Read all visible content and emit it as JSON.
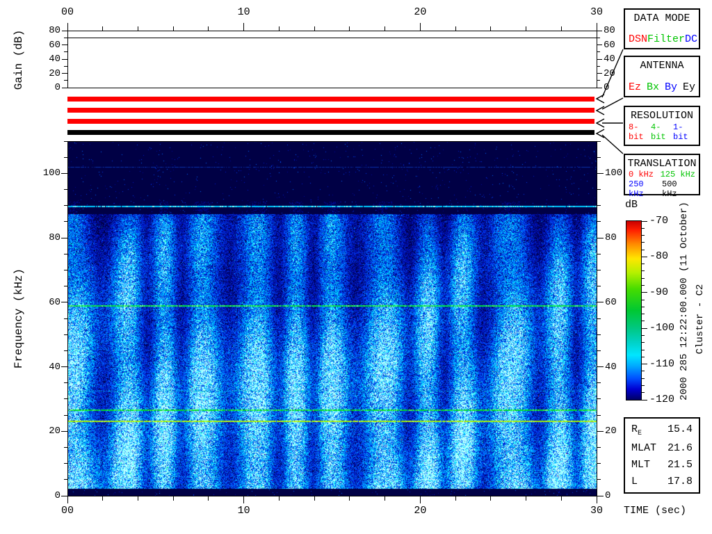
{
  "labels": {
    "gain_axis": "Gain (dB)",
    "freq_axis": "Frequency (kHz)",
    "time_axis": "TIME (sec)",
    "colorbar_title": "dB",
    "timestamp_rotated": "2000 285 12:22:00.000 (11 October)",
    "spacecraft_rotated": "Cluster - C2"
  },
  "colors": {
    "red": "#ff0000",
    "green": "#00c400",
    "blue": "#0000ff",
    "black": "#000000",
    "plot_background_navy": "#000045"
  },
  "status_bars": [
    {
      "name": "data-mode-bar",
      "color": "#ff0000"
    },
    {
      "name": "antenna-bar",
      "color": "#ff0000"
    },
    {
      "name": "resolution-bar",
      "color": "#ff0000"
    },
    {
      "name": "translation-bar",
      "color": "#000000"
    }
  ],
  "legend_boxes": [
    {
      "title": "DATA MODE",
      "rows": [
        [
          {
            "label": "DSN",
            "color": "#ff0000"
          },
          {
            "label": "Filter",
            "color": "#00c400"
          },
          {
            "label": "DC",
            "color": "#0000ff"
          }
        ]
      ]
    },
    {
      "title": "ANTENNA",
      "rows": [
        [
          {
            "label": "Ez",
            "color": "#ff0000"
          },
          {
            "label": "Bx",
            "color": "#00c400"
          },
          {
            "label": "By",
            "color": "#0000ff"
          },
          {
            "label": "Ey",
            "color": "#000000"
          }
        ]
      ]
    },
    {
      "title": "RESOLUTION",
      "rows": [
        [
          {
            "label": "8-bit",
            "color": "#ff0000"
          },
          {
            "label": "4-bit",
            "color": "#00c400"
          },
          {
            "label": "1-bit",
            "color": "#0000ff"
          }
        ]
      ]
    },
    {
      "title": "TRANSLATION",
      "rows": [
        [
          {
            "label": "0 kHz",
            "color": "#ff0000"
          },
          {
            "label": "125 kHz",
            "color": "#00c400"
          }
        ],
        [
          {
            "label": "250 kHz",
            "color": "#0000ff"
          },
          {
            "label": "500 kHz",
            "color": "#000000"
          }
        ]
      ]
    }
  ],
  "ephemeris": {
    "rows": [
      {
        "label": "R",
        "sub": "E",
        "value": "15.4"
      },
      {
        "label": "MLAT",
        "sub": "",
        "value": "21.6"
      },
      {
        "label": "MLT",
        "sub": "",
        "value": "21.5"
      },
      {
        "label": "L",
        "sub": "",
        "value": "17.8"
      }
    ]
  },
  "chart_data": [
    {
      "type": "line",
      "title": "Receiver gain vs time",
      "x_axis": {
        "range_sec": [
          0,
          30
        ],
        "label_values": [
          0,
          10,
          20,
          30
        ],
        "labels": [
          "00",
          "10",
          "20",
          "30"
        ],
        "minor_step_sec": 2
      },
      "y_axis": {
        "title": "Gain (dB)",
        "range_db": [
          0,
          80
        ],
        "label_values": [
          0,
          20,
          40,
          60,
          80
        ],
        "labels": [
          "0",
          "20",
          "40",
          "60",
          "80"
        ],
        "minor_step_db": 10
      },
      "series": [
        {
          "name": "gain",
          "shape": "constant",
          "value_db": 70
        }
      ]
    },
    {
      "type": "heatmap",
      "title": "Cluster WBD wideband spectrogram",
      "x_axis": {
        "title": "TIME (sec)",
        "range_sec": [
          0,
          30
        ],
        "label_values": [
          0,
          10,
          20,
          30
        ],
        "labels": [
          "00",
          "10",
          "20",
          "30"
        ],
        "minor_step_sec": 2
      },
      "y_axis": {
        "title": "Frequency (kHz)",
        "range_khz": [
          0,
          110
        ],
        "label_values": [
          0,
          20,
          40,
          60,
          80,
          100
        ],
        "labels": [
          "0",
          "20",
          "40",
          "60",
          "80",
          "100"
        ],
        "minor_step_khz": 5
      },
      "colorbar": {
        "title": "dB",
        "range_db": [
          -120,
          -70
        ],
        "label_values": [
          -70,
          -80,
          -90,
          -100,
          -110,
          -120
        ],
        "labels": [
          "-70",
          "-80",
          "-90",
          "-100",
          "-110",
          "-120"
        ],
        "minor_step_db": 2,
        "stops": [
          [
            0,
            "#c80000"
          ],
          [
            0.05,
            "#ff1e00"
          ],
          [
            0.13,
            "#ff8c00"
          ],
          [
            0.21,
            "#ffe600"
          ],
          [
            0.29,
            "#b4f000"
          ],
          [
            0.38,
            "#46dc00"
          ],
          [
            0.5,
            "#00c832"
          ],
          [
            0.6,
            "#00c882"
          ],
          [
            0.68,
            "#00d2c8"
          ],
          [
            0.75,
            "#00e6ff"
          ],
          [
            0.81,
            "#00aaff"
          ],
          [
            0.88,
            "#0050ff"
          ],
          [
            0.94,
            "#0000d2"
          ],
          [
            1,
            "#000064"
          ]
        ]
      },
      "description": "Broadband blue/cyan noise below ~88 kHz with quasi-periodic vertical banding (~2.5 s period); dark navy (no signal) above ~90 kHz",
      "spectral_lines": [
        {
          "freq_khz": 102,
          "color": "#0a2fa8",
          "bright": "",
          "width": 1,
          "density": 0.7
        },
        {
          "freq_khz": 90,
          "color": "#00c8ff",
          "bright": "#86ffff",
          "width": 2,
          "density": 0.97
        },
        {
          "freq_khz": 59,
          "color": "#00e046",
          "bright": "#7dff7d",
          "width": 2,
          "density": 0.97
        },
        {
          "freq_khz": 32.5,
          "color": "#0096d2",
          "bright": "",
          "width": 1,
          "density": 0.55
        },
        {
          "freq_khz": 26.8,
          "color": "#00dc28",
          "bright": "#64ff64",
          "width": 2,
          "density": 0.95
        },
        {
          "freq_khz": 23.2,
          "color": "#a0f000",
          "bright": "#d2ff46",
          "width": 2,
          "density": 0.97
        }
      ],
      "render": {
        "seed": 1234567,
        "band_period_sec": 2.45,
        "noise_top_khz": 87.5,
        "palette": [
          [
            0.1,
            "#000045"
          ],
          [
            0.17,
            "#000998"
          ],
          [
            0.24,
            "#001ac8"
          ],
          [
            0.32,
            "#0038e8"
          ],
          [
            0.4,
            "#0061ff"
          ],
          [
            0.48,
            "#008cff"
          ],
          [
            0.57,
            "#00b3ff"
          ],
          [
            0.67,
            "#00deff"
          ],
          [
            0.8,
            "#59ffff"
          ],
          [
            99,
            "#b8ffff"
          ]
        ],
        "green_dot": "#00ff55",
        "red_dot": "#ff3232"
      }
    }
  ]
}
